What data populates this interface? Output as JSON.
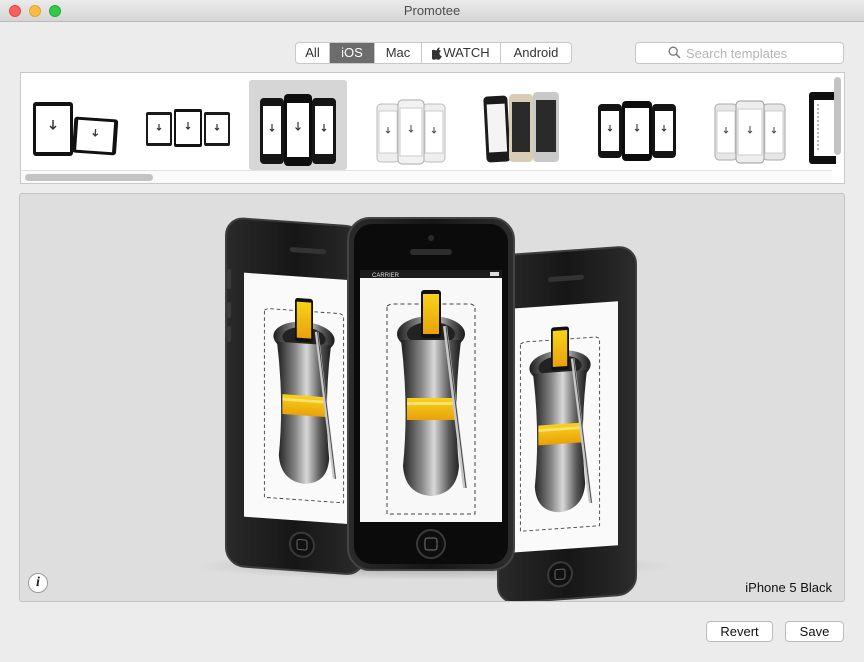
{
  "window": {
    "title": "Promotee"
  },
  "filters": {
    "tabs": [
      {
        "label": "All",
        "active": false
      },
      {
        "label": "iOS",
        "active": true
      },
      {
        "label": "Mac",
        "active": false
      },
      {
        "label": "WATCH",
        "active": false
      },
      {
        "label": "Android",
        "active": false
      }
    ]
  },
  "search": {
    "placeholder": "Search templates",
    "value": ""
  },
  "templates": {
    "selected_index": 2,
    "items": [
      {
        "icon": "ipad-pair-icon"
      },
      {
        "icon": "ipad-triple-icon"
      },
      {
        "icon": "iphone-5-black-triple-icon"
      },
      {
        "icon": "iphone-white-triple-icon"
      },
      {
        "icon": "iphone-5s-trio-icon"
      },
      {
        "icon": "iphone-black-triple-icon"
      },
      {
        "icon": "iphone-silver-triple-icon"
      },
      {
        "icon": "ipad-partial-icon"
      }
    ]
  },
  "preview": {
    "device_label": "iPhone 5 Black",
    "carrier_text": "CARRIER",
    "info_label": "i"
  },
  "footer": {
    "revert_label": "Revert",
    "save_label": "Save"
  }
}
